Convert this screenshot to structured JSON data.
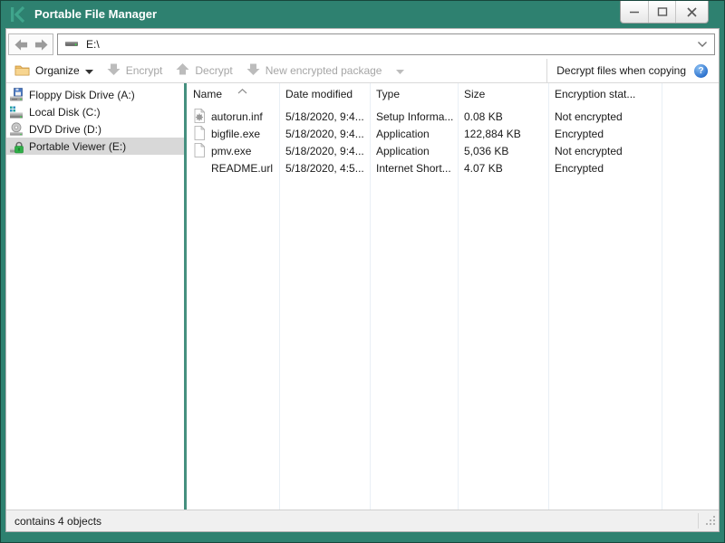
{
  "window": {
    "title": "Portable File Manager"
  },
  "titlebar": {
    "controls": [
      "minimize",
      "maximize",
      "close"
    ]
  },
  "navbar": {
    "address": "E:\\"
  },
  "toolbar": {
    "organize_label": "Organize",
    "encrypt_label": "Encrypt",
    "decrypt_label": "Decrypt",
    "new_package_label": "New encrypted package",
    "decrypt_copy_label": "Decrypt files when copying"
  },
  "sidebar": {
    "items": [
      {
        "label": "Floppy Disk Drive (A:)",
        "icon": "floppy-drive-icon",
        "selected": false
      },
      {
        "label": "Local Disk (C:)",
        "icon": "local-disk-icon",
        "selected": false
      },
      {
        "label": "DVD Drive (D:)",
        "icon": "dvd-drive-icon",
        "selected": false
      },
      {
        "label": "Portable Viewer (E:)",
        "icon": "locked-drive-icon",
        "selected": true
      }
    ]
  },
  "filelist": {
    "columns": [
      "Name",
      "Date modified",
      "Type",
      "Size",
      "Encryption stat..."
    ],
    "sort": {
      "column": "Name",
      "direction": "ascending"
    },
    "rows": [
      {
        "name": "autorun.inf",
        "date_modified": "5/18/2020, 9:4...",
        "type": "Setup Informa...",
        "size": "0.08 KB",
        "encryption_status": "Not encrypted",
        "icon": "setup-information-file-icon"
      },
      {
        "name": "bigfile.exe",
        "date_modified": "5/18/2020, 9:4...",
        "type": "Application",
        "size": "122,884 KB",
        "encryption_status": "Encrypted",
        "icon": "file-icon"
      },
      {
        "name": "pmv.exe",
        "date_modified": "5/18/2020, 9:4...",
        "type": "Application",
        "size": "5,036 KB",
        "encryption_status": "Not encrypted",
        "icon": "file-icon"
      },
      {
        "name": "README.url",
        "date_modified": "5/18/2020, 4:5...",
        "type": "Internet Short...",
        "size": "4.07 KB",
        "encryption_status": "Encrypted",
        "icon": "none"
      }
    ]
  },
  "statusbar": {
    "text": "contains 4 objects"
  },
  "colors": {
    "titlebar_teal": "#2e8170",
    "frame_dark": "#17453b",
    "pane_divider": "#45907f",
    "selection_gray": "#d8d8d8",
    "disabled_text": "#a6a6a6",
    "help_blue": "#2f74cf"
  }
}
